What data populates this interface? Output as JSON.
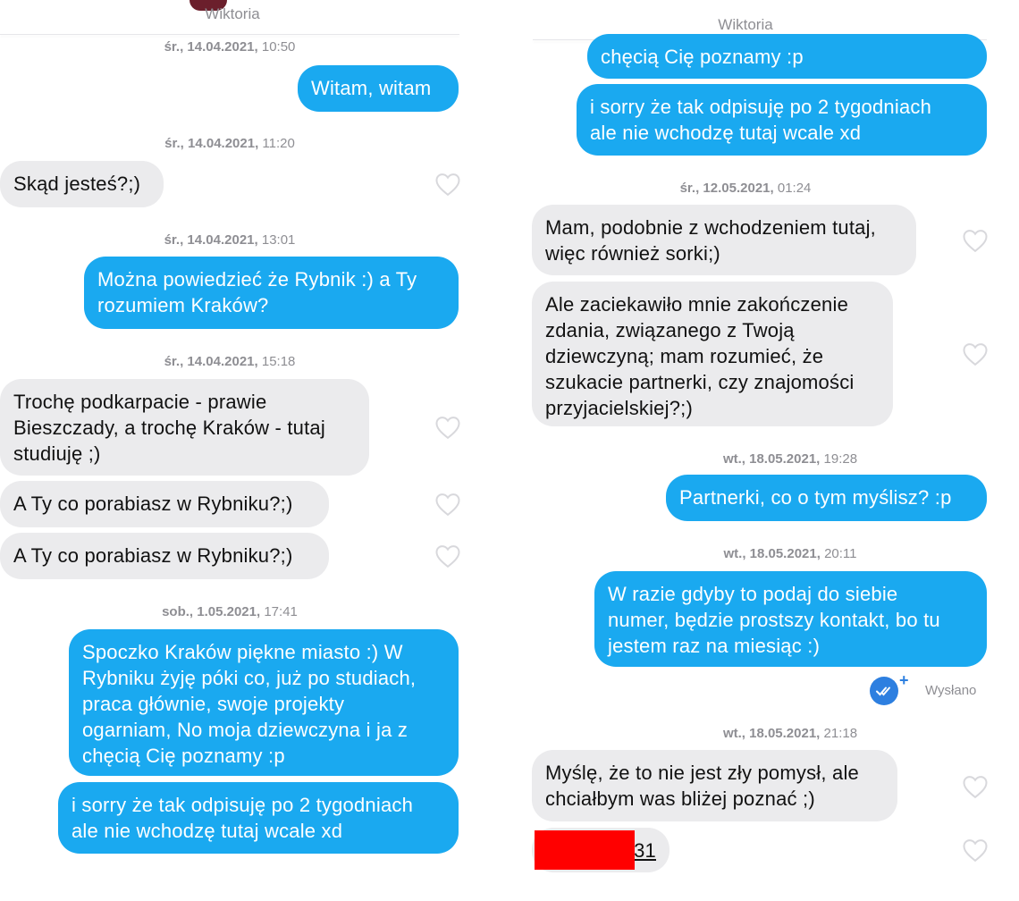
{
  "left": {
    "header": {
      "name": "Wiktoria"
    },
    "messages": [
      {
        "timestamp_day": "śr., 14.04.2021,",
        "timestamp_time": "10:50"
      },
      {
        "text": "Witam, witam"
      },
      {
        "timestamp_day": "śr., 14.04.2021,",
        "timestamp_time": "11:20"
      },
      {
        "text": "Skąd jesteś?;)"
      },
      {
        "timestamp_day": "śr., 14.04.2021,",
        "timestamp_time": "13:01"
      },
      {
        "text": "Można powiedzieć że Rybnik :) a Ty\nrozumiem Kraków?"
      },
      {
        "timestamp_day": "śr., 14.04.2021,",
        "timestamp_time": "15:18"
      },
      {
        "text": "Trochę podkarpacie - prawie\nBieszczady, a trochę Kraków - tutaj\nstudiuję ;)"
      },
      {
        "text": "A Ty co porabiasz w Rybniku?;)"
      },
      {
        "text": "A Ty co porabiasz w Rybniku?;)"
      },
      {
        "timestamp_day": "sob., 1.05.2021,",
        "timestamp_time": "17:41"
      },
      {
        "text": "Spoczko Kraków piękne miasto :) W\nRybniku żyję póki co, już po studiach,\npraca głównie, swoje projekty\nogarniam, No moja dziewczyna i ja z\nchęcią Cię poznamy :p"
      },
      {
        "text": "i sorry że tak odpisuję po 2 tygodniach\nale nie wchodzę tutaj wcale xd"
      }
    ]
  },
  "right": {
    "header": {
      "name": "Wiktoria"
    },
    "messages": [
      {
        "text": "chęcią Cię poznamy :p"
      },
      {
        "text": "i sorry że tak odpisuję po 2 tygodniach\nale nie wchodzę tutaj wcale xd"
      },
      {
        "timestamp_day": "śr., 12.05.2021,",
        "timestamp_time": "01:24"
      },
      {
        "text": "Mam, podobnie z wchodzeniem tutaj,\nwięc również sorki;)"
      },
      {
        "text": "Ale zaciekawiło mnie zakończenie\nzdania, związanego z Twoją\ndziewczyną; mam rozumieć, że\nszukacie partnerki, czy znajomości\nprzyjacielskiej?;)"
      },
      {
        "timestamp_day": "wt., 18.05.2021,",
        "timestamp_time": "19:28"
      },
      {
        "text": "Partnerki, co o tym myślisz? :p"
      },
      {
        "timestamp_day": "wt., 18.05.2021,",
        "timestamp_time": "20:11"
      },
      {
        "text": "W razie gdyby to podaj do siebie\nnumer, będzie prostszy kontakt, bo tu\njestem raz na miesiąc :)"
      },
      {
        "status": "Wysłano"
      },
      {
        "timestamp_day": "wt., 18.05.2021,",
        "timestamp_time": "21:18"
      },
      {
        "text": "Myślę, że to nie jest zły pomysł, ale\nchciałbym was bliżej poznać ;)"
      },
      {
        "text": "31"
      }
    ]
  },
  "colors": {
    "outgoing_bubble": "#1aa9f0",
    "incoming_bubble": "#ebebed",
    "timestamp": "#8e8e93",
    "sent_icon": "#2d7fe0",
    "redaction": "#ff0000"
  },
  "icons": {
    "like": "heart-outline-icon",
    "read_receipt": "double-check-icon"
  }
}
